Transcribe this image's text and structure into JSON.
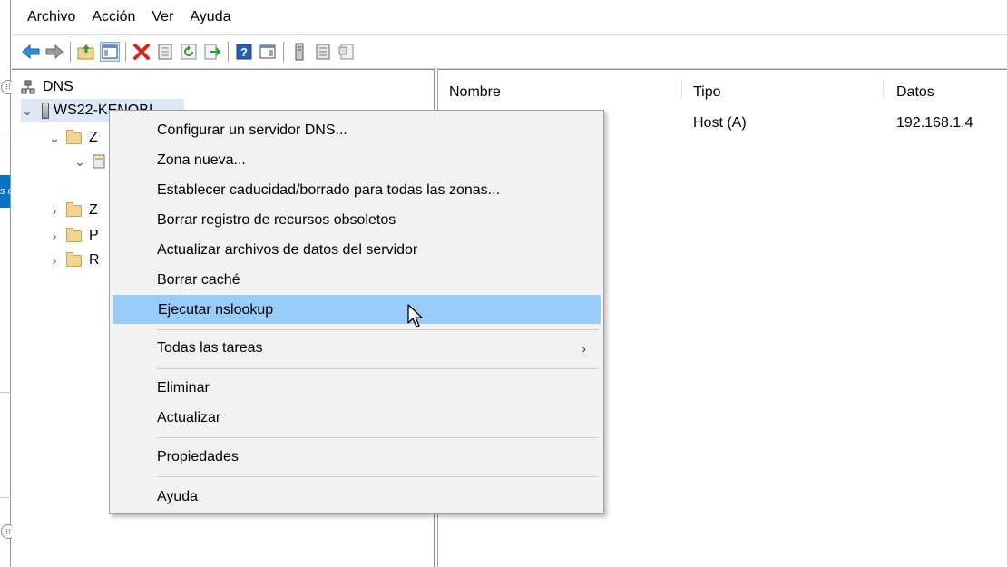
{
  "menubar": {
    "items": [
      "Archivo",
      "Acción",
      "Ver",
      "Ayuda"
    ]
  },
  "toolbar": {
    "buttons": [
      "back-arrow-icon",
      "forward-arrow-icon",
      "up-folder-icon",
      "show-hide-tree-icon",
      "delete-icon",
      "properties-icon",
      "refresh-icon",
      "export-list-icon",
      "help-icon",
      "console-icon",
      "server-icon",
      "zone-icon",
      "record-icon"
    ]
  },
  "tree": {
    "root": "DNS",
    "server": "WS22-KENOBI",
    "nodes": [
      "Z",
      "",
      "Z",
      "P",
      "R"
    ]
  },
  "list": {
    "headers": {
      "name": "Nombre",
      "type": "Tipo",
      "data": "Datos"
    },
    "rows": [
      {
        "name": "",
        "type": "Host (A)",
        "data": "192.168.1.4"
      }
    ]
  },
  "context_menu": {
    "items": [
      "Configurar un servidor DNS...",
      "Zona nueva...",
      "Establecer caducidad/borrado para todas las zonas...",
      "Borrar registro de recursos obsoletos",
      "Actualizar archivos de datos del servidor",
      "Borrar caché",
      "Ejecutar nslookup",
      "Todas las tareas",
      "Eliminar",
      "Actualizar",
      "Propiedades",
      "Ayuda"
    ],
    "highlighted": "Ejecutar nslookup",
    "submenu_arrow": "›"
  },
  "frame": {
    "blue_tab_text": "s c"
  },
  "colors": {
    "highlight": "#99ccf8",
    "menu_bg": "#f2f2f2",
    "accent_blue": "#0a73c9"
  }
}
